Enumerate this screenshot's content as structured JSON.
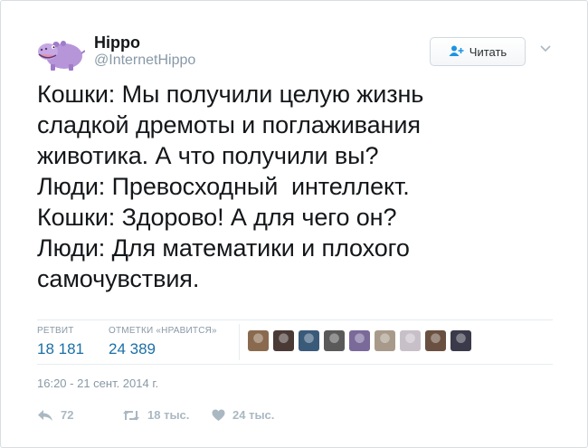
{
  "user": {
    "display_name": "Hippo",
    "handle": "@InternetHippo",
    "avatar_icon": "hippo-avatar"
  },
  "follow_button": {
    "label": "Читать",
    "icon": "follow-user-icon"
  },
  "tweet": {
    "text": "Кошки: Мы получили целую жизнь\nсладкой дремоты и поглаживания\nживотика. А что получили вы?\nЛюди: Превосходный  интеллект.\nКошки: Здорово! А для чего он?\nЛюди: Для математики и плохого\nсамочувствия."
  },
  "stats": {
    "retweets_label": "РЕТВИТ",
    "retweets_value": "18 181",
    "likes_label": "ОТМЕТКИ «НРАВИТСЯ»",
    "likes_value": "24 389"
  },
  "likers": [
    "#8a6a4e",
    "#4a3a36",
    "#3a5a7a",
    "#5a5a5a",
    "#7a6a9a",
    "#a89a8a",
    "#c8c0c8",
    "#6a5040",
    "#3a3a4a"
  ],
  "timestamp": "16:20 - 21 сент. 2014 г.",
  "actions": {
    "reply_count": "72",
    "retweet_count": "18 тыс.",
    "like_count": "24 тыс."
  },
  "colors": {
    "accent": "#1b6fa6",
    "muted": "#8899a6",
    "icon": "#aab8c2",
    "avatar": "#b795d9"
  }
}
